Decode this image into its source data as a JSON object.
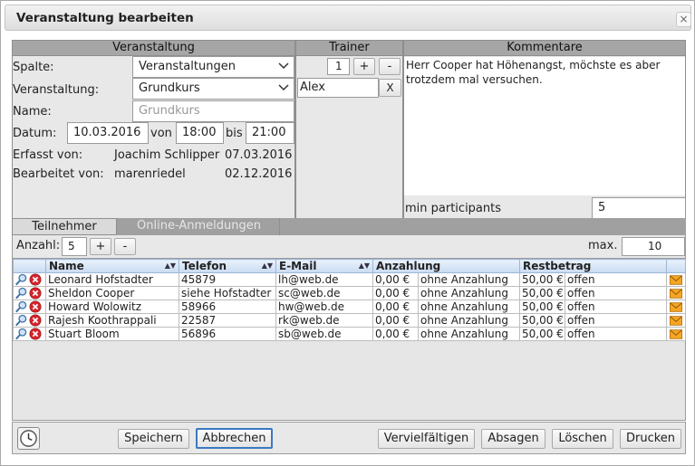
{
  "dialog": {
    "title": "Veranstaltung bearbeiten",
    "close_glyph": "×"
  },
  "veranstaltung": {
    "header": "Veranstaltung",
    "spalte_label": "Spalte:",
    "spalte_value": "Veranstaltungen",
    "veranstaltung_label": "Veranstaltung:",
    "veranstaltung_value": "Grundkurs",
    "name_label": "Name:",
    "name_placeholder": "Grundkurs",
    "datum_label": "Datum:",
    "datum_value": "10.03.2016",
    "von_label": "von",
    "von_value": "18:00",
    "bis_label": "bis",
    "bis_value": "21:00",
    "erfasst_label": "Erfasst von:",
    "erfasst_name": "Joachim Schlipper",
    "erfasst_date": "07.03.2016",
    "bearbeitet_label": "Bearbeitet von:",
    "bearbeitet_name": "marenriedel",
    "bearbeitet_date": "02.12.2016"
  },
  "trainer": {
    "header": "Trainer",
    "count": "1",
    "plus": "+",
    "minus": "-",
    "name": "Alex",
    "remove": "X"
  },
  "kommentare": {
    "header": "Kommentare",
    "text": "Herr Cooper hat Höhenangst, möchste es aber trotzdem mal versuchen.",
    "min_label": "min participants",
    "min_value": "5"
  },
  "tabs": [
    {
      "label": "Teilnehmer",
      "active": true
    },
    {
      "label": "Online-Anmeldungen",
      "active": false
    }
  ],
  "toolbar": {
    "anzahl_label": "Anzahl:",
    "anzahl_value": "5",
    "plus": "+",
    "minus": "-",
    "max_label": "max.",
    "max_value": "10"
  },
  "table": {
    "headers": [
      "Name",
      "Telefon",
      "E-Mail",
      "Anzahlung",
      "Restbetrag"
    ],
    "rows": [
      {
        "name": "Leonard Hofstadter",
        "telefon": "45879",
        "email": "lh@web.de",
        "anzahlung": "0,00 €",
        "anz_status": "ohne Anzahlung",
        "rest": "50,00 €",
        "rest_status": "offen"
      },
      {
        "name": "Sheldon Cooper",
        "telefon": "siehe Hofstadter",
        "email": "sc@web.de",
        "anzahlung": "0,00 €",
        "anz_status": "ohne Anzahlung",
        "rest": "50,00 €",
        "rest_status": "offen"
      },
      {
        "name": "Howard Wolowitz",
        "telefon": "58966",
        "email": "hw@web.de",
        "anzahlung": "0,00 €",
        "anz_status": "ohne Anzahlung",
        "rest": "50,00 €",
        "rest_status": "offen"
      },
      {
        "name": "Rajesh Koothrappali",
        "telefon": "22587",
        "email": "rk@web.de",
        "anzahlung": "0,00 €",
        "anz_status": "ohne Anzahlung",
        "rest": "50,00 €",
        "rest_status": "offen"
      },
      {
        "name": "Stuart Bloom",
        "telefon": "56896",
        "email": "sb@web.de",
        "anzahlung": "0,00 €",
        "anz_status": "ohne Anzahlung",
        "rest": "50,00 €",
        "rest_status": "offen"
      }
    ]
  },
  "footer": {
    "speichern": "Speichern",
    "abbrechen": "Abbrechen",
    "vervielfaeltigen": "Vervielfältigen",
    "absagen": "Absagen",
    "loeschen": "Löschen",
    "drucken": "Drucken"
  },
  "icons": {
    "view": "magnifier-icon",
    "delete": "delete-icon",
    "mail": "envelope-icon",
    "history": "clock-icon"
  },
  "colors": {
    "section_header": "#a6a6a6",
    "panel": "#e8e8e8",
    "table_header": "#c9dbf2",
    "delete_red": "#d8242b",
    "primary_border": "#3b78c2"
  }
}
